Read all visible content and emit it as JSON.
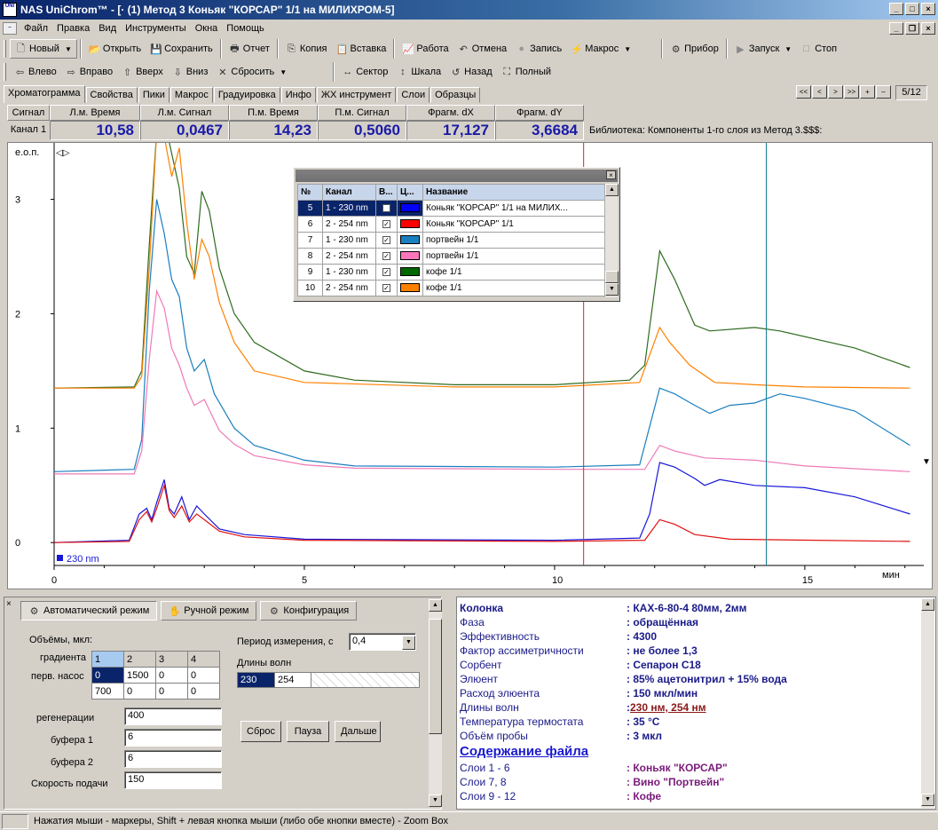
{
  "window": {
    "title": "NAS UniChrom™ - [· (1) Метод 3 Коньяк \"КОРСАР\" 1/1  на  МИЛИХРОМ-5]",
    "app_icon": "UNI"
  },
  "menu": [
    "Файл",
    "Правка",
    "Вид",
    "Инструменты",
    "Окна",
    "Помощь"
  ],
  "toolbar1": {
    "new": "Новый",
    "open": "Открыть",
    "save": "Сохранить",
    "report": "Отчет",
    "copy": "Копия",
    "paste": "Вставка",
    "work": "Работа",
    "undo": "Отмена",
    "record": "Запись",
    "macro": "Макрос",
    "device": "Прибор",
    "start": "Запуск",
    "stop": "Стоп"
  },
  "toolbar2": {
    "left": "Влево",
    "right": "Вправо",
    "up": "Вверх",
    "down": "Вниз",
    "reset": "Сбросить",
    "sector": "Сектор",
    "scale": "Шкала",
    "back": "Назад",
    "full": "Полный"
  },
  "tabs": [
    "Хроматограмма",
    "Свойства",
    "Пики",
    "Макрос",
    "Градуировка",
    "Инфо",
    "ЖХ инструмент",
    "Слои",
    "Образцы"
  ],
  "nav": {
    "buttons": [
      "<<",
      "<",
      ">",
      ">>",
      "+",
      "–"
    ],
    "page": "5/12"
  },
  "measure": {
    "headers": [
      "Сигнал",
      "Л.м. Время",
      "Л.м. Сигнал",
      "П.м. Время",
      "П.м. Сигнал",
      "Фрагм. dX",
      "Фрагм. dY"
    ],
    "channel": "Канал 1",
    "values": [
      "10,58",
      "0,0467",
      "14,23",
      "0,5060",
      "17,127",
      "3,6684"
    ],
    "library": "Библиотека: Компоненты 1-го слоя из Метод 3.$$$:"
  },
  "chart_data": {
    "type": "line",
    "ylabel": "е.о.п.",
    "xunit": "мин",
    "xlim": [
      0,
      17.2
    ],
    "ylim": [
      -0.2,
      3.4
    ],
    "xticks": [
      0,
      5,
      10,
      15
    ],
    "yticks": [
      0,
      1,
      2,
      3
    ],
    "cursor_left": 10.58,
    "cursor_right": 14.23,
    "channel_label": "230 nm",
    "series": [
      {
        "color": "#2e6b1e",
        "points": [
          [
            0,
            1.35
          ],
          [
            1.6,
            1.36
          ],
          [
            1.75,
            1.5
          ],
          [
            1.9,
            2.6
          ],
          [
            2.05,
            3.6
          ],
          [
            2.2,
            3.7
          ],
          [
            2.35,
            3.4
          ],
          [
            2.5,
            3.1
          ],
          [
            2.65,
            2.5
          ],
          [
            2.8,
            2.35
          ],
          [
            2.95,
            3.07
          ],
          [
            3.1,
            2.9
          ],
          [
            3.3,
            2.4
          ],
          [
            3.6,
            2.0
          ],
          [
            4,
            1.75
          ],
          [
            5,
            1.5
          ],
          [
            6,
            1.42
          ],
          [
            8,
            1.38
          ],
          [
            10,
            1.38
          ],
          [
            11.5,
            1.42
          ],
          [
            11.8,
            1.55
          ],
          [
            12.1,
            2.55
          ],
          [
            12.4,
            2.3
          ],
          [
            12.8,
            1.9
          ],
          [
            13.1,
            1.85
          ],
          [
            14,
            1.88
          ],
          [
            14.5,
            1.85
          ],
          [
            16,
            1.7
          ],
          [
            17.1,
            1.53
          ]
        ]
      },
      {
        "color": "#ff8000",
        "points": [
          [
            0,
            1.35
          ],
          [
            1.6,
            1.35
          ],
          [
            1.75,
            1.45
          ],
          [
            1.9,
            2.4
          ],
          [
            2.05,
            3.6
          ],
          [
            2.2,
            3.55
          ],
          [
            2.35,
            3.2
          ],
          [
            2.5,
            3.45
          ],
          [
            2.65,
            2.8
          ],
          [
            2.8,
            2.3
          ],
          [
            2.95,
            2.65
          ],
          [
            3.1,
            2.5
          ],
          [
            3.3,
            2.1
          ],
          [
            3.6,
            1.75
          ],
          [
            4,
            1.5
          ],
          [
            5,
            1.4
          ],
          [
            8,
            1.36
          ],
          [
            10,
            1.36
          ],
          [
            11.7,
            1.4
          ],
          [
            12.1,
            1.88
          ],
          [
            12.3,
            1.75
          ],
          [
            12.7,
            1.55
          ],
          [
            13.2,
            1.4
          ],
          [
            14,
            1.38
          ],
          [
            15,
            1.36
          ],
          [
            17.1,
            1.35
          ]
        ]
      },
      {
        "color": "#1a7fbf",
        "points": [
          [
            0,
            0.62
          ],
          [
            1.6,
            0.64
          ],
          [
            1.75,
            0.9
          ],
          [
            1.9,
            2.2
          ],
          [
            2.05,
            3.0
          ],
          [
            2.2,
            2.7
          ],
          [
            2.35,
            2.3
          ],
          [
            2.5,
            2.15
          ],
          [
            2.65,
            1.7
          ],
          [
            2.8,
            1.5
          ],
          [
            3.0,
            1.6
          ],
          [
            3.2,
            1.3
          ],
          [
            3.6,
            1.0
          ],
          [
            4,
            0.85
          ],
          [
            5,
            0.72
          ],
          [
            6,
            0.67
          ],
          [
            10,
            0.66
          ],
          [
            11.7,
            0.68
          ],
          [
            12.1,
            1.35
          ],
          [
            12.4,
            1.3
          ],
          [
            12.8,
            1.2
          ],
          [
            13.1,
            1.13
          ],
          [
            13.5,
            1.2
          ],
          [
            14,
            1.22
          ],
          [
            14.5,
            1.3
          ],
          [
            15,
            1.26
          ],
          [
            16,
            1.15
          ],
          [
            17.1,
            0.85
          ]
        ]
      },
      {
        "color": "#ee7ab6",
        "points": [
          [
            0,
            0.6
          ],
          [
            1.6,
            0.6
          ],
          [
            1.75,
            0.8
          ],
          [
            1.9,
            1.6
          ],
          [
            2.05,
            2.2
          ],
          [
            2.2,
            2.05
          ],
          [
            2.35,
            1.7
          ],
          [
            2.5,
            1.55
          ],
          [
            2.65,
            1.35
          ],
          [
            2.8,
            1.2
          ],
          [
            3.0,
            1.25
          ],
          [
            3.3,
            0.98
          ],
          [
            3.6,
            0.86
          ],
          [
            4,
            0.76
          ],
          [
            5,
            0.68
          ],
          [
            6,
            0.65
          ],
          [
            10,
            0.64
          ],
          [
            11.8,
            0.64
          ],
          [
            12.1,
            0.85
          ],
          [
            12.4,
            0.8
          ],
          [
            13,
            0.74
          ],
          [
            14,
            0.72
          ],
          [
            15,
            0.67
          ],
          [
            17.1,
            0.62
          ]
        ]
      },
      {
        "color": "#1717d9",
        "points": [
          [
            0,
            0
          ],
          [
            1.5,
            0.02
          ],
          [
            1.7,
            0.25
          ],
          [
            1.85,
            0.3
          ],
          [
            1.95,
            0.2
          ],
          [
            2.05,
            0.35
          ],
          [
            2.2,
            0.55
          ],
          [
            2.3,
            0.3
          ],
          [
            2.4,
            0.25
          ],
          [
            2.55,
            0.4
          ],
          [
            2.7,
            0.2
          ],
          [
            2.85,
            0.32
          ],
          [
            3.0,
            0.25
          ],
          [
            3.3,
            0.12
          ],
          [
            3.8,
            0.07
          ],
          [
            5,
            0.03
          ],
          [
            10,
            0.02
          ],
          [
            11.7,
            0.04
          ],
          [
            11.9,
            0.25
          ],
          [
            12.1,
            0.7
          ],
          [
            12.4,
            0.66
          ],
          [
            12.8,
            0.56
          ],
          [
            13.0,
            0.5
          ],
          [
            13.3,
            0.55
          ],
          [
            14,
            0.5
          ],
          [
            15,
            0.48
          ],
          [
            16,
            0.4
          ],
          [
            17.1,
            0.25
          ]
        ]
      },
      {
        "color": "#e01010",
        "points": [
          [
            0,
            0
          ],
          [
            1.5,
            0.01
          ],
          [
            1.7,
            0.2
          ],
          [
            1.85,
            0.27
          ],
          [
            1.95,
            0.18
          ],
          [
            2.05,
            0.3
          ],
          [
            2.2,
            0.5
          ],
          [
            2.3,
            0.28
          ],
          [
            2.4,
            0.22
          ],
          [
            2.55,
            0.32
          ],
          [
            2.7,
            0.18
          ],
          [
            2.85,
            0.25
          ],
          [
            3.0,
            0.2
          ],
          [
            3.3,
            0.1
          ],
          [
            3.8,
            0.05
          ],
          [
            5,
            0.02
          ],
          [
            10,
            0.01
          ],
          [
            11.8,
            0.02
          ],
          [
            12.1,
            0.2
          ],
          [
            12.4,
            0.16
          ],
          [
            12.8,
            0.07
          ],
          [
            13.5,
            0.03
          ],
          [
            17.1,
            0.01
          ]
        ]
      }
    ]
  },
  "legend": {
    "headers": [
      "№",
      "Канал",
      "В...",
      "Ц...",
      "Название"
    ],
    "rows": [
      {
        "n": "5",
        "ch": "1 - 230 nm",
        "color": "#0000ff",
        "name": "Коньяк \"КОРСАР\" 1/1  на  МИЛИХ..."
      },
      {
        "n": "6",
        "ch": "2 - 254 nm",
        "color": "#ff0000",
        "name": "Коньяк \"КОРСАР\" 1/1"
      },
      {
        "n": "7",
        "ch": "1 - 230 nm",
        "color": "#1a7fbf",
        "name": "портвейн 1/1"
      },
      {
        "n": "8",
        "ch": "2 - 254 nm",
        "color": "#ff77bb",
        "name": "портвейн 1/1"
      },
      {
        "n": "9",
        "ch": "1 - 230 nm",
        "color": "#006600",
        "name": "кофе 1/1"
      },
      {
        "n": "10",
        "ch": "2 - 254 nm",
        "color": "#ff8000",
        "name": "кофе 1/1"
      }
    ]
  },
  "bottom_tabs": [
    "Автоматический режим",
    "Ручной режим",
    "Конфигурация"
  ],
  "gradient": {
    "volumes_label": "Объёмы, мкл:",
    "gradient_label": "градиента",
    "pump_label": "перв. насос",
    "cols": [
      "1",
      "2",
      "3",
      "4"
    ],
    "row1": [
      "0",
      "1500",
      "0",
      "0"
    ],
    "row2": [
      "700",
      "0",
      "0",
      "0"
    ],
    "regen_label": "регенерации",
    "regen": "400",
    "buf1_label": "буфера 1",
    "buf1": "6",
    "buf2_label": "буфера 2",
    "buf2": "6",
    "speed_label": "Скорость подачи",
    "speed": "150",
    "period_label": "Период измерения, с",
    "period": "0,4",
    "wl_label": "Длины волн",
    "wl": [
      "230",
      "254"
    ],
    "btn_reset": "Сброс",
    "btn_pause": "Пауза",
    "btn_next": "Дальше"
  },
  "info": {
    "rows": [
      {
        "k": "Колонка",
        "v": ": КАХ-6-80-4 80мм, 2мм",
        "bold": true
      },
      {
        "k": "Фаза",
        "v": ": обращённая"
      },
      {
        "k": "Эффективность",
        "v": ": 4300"
      },
      {
        "k": "Фактор ассиметричности",
        "v": ": не более 1,3"
      },
      {
        "k": "Сорбент",
        "v": ": Сепарон С18"
      },
      {
        "k": "Элюент",
        "v": ": 85% ацетонитрил + 15% вода"
      },
      {
        "k": "Расход элюента",
        "v": ": 150 мкл/мин"
      },
      {
        "k": "Длины волн",
        "v": "230 нм, 254 нм",
        "link": true
      },
      {
        "k": "Температура термостата",
        "v": ": 35 °С"
      },
      {
        "k": "Объём пробы",
        "v": ": 3 мкл"
      }
    ],
    "section": "Содержание файла",
    "layers": [
      {
        "k": "Слои 1 - 6",
        "v": ": Коньяк \"КОРСАР\""
      },
      {
        "k": "Слои 7, 8",
        "v": ": Вино \"Портвейн\""
      },
      {
        "k": "Слои 9 - 12",
        "v": ": Кофе"
      }
    ]
  },
  "status": "Нажатия мыши - маркеры, Shift + левая кнопка мыши  (либо обе кнопки вместе) - Zoom Box"
}
